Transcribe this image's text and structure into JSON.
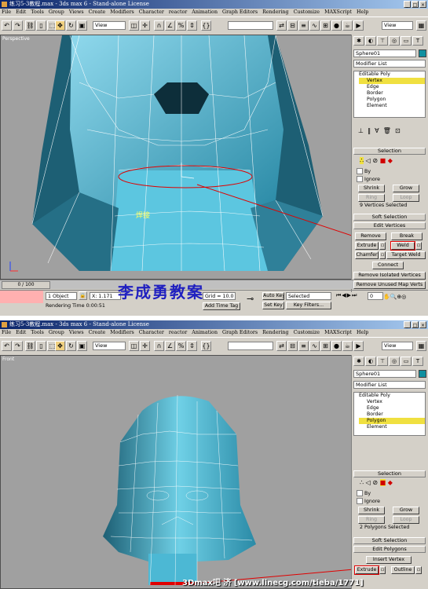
{
  "screen1": {
    "title": "练习5-3教程.max - 3ds max 6 - Stand-alone License",
    "menu": [
      "File",
      "Edit",
      "Tools",
      "Group",
      "Views",
      "Create",
      "Modifiers",
      "Character",
      "reactor",
      "Animation",
      "Graph Editors",
      "Rendering",
      "Customize",
      "MAXScript",
      "Help"
    ],
    "viewport_label": "Perspective",
    "view_dropdown": "View",
    "view_dropdown_right": "View",
    "object_name": "Sphere01",
    "modifier_list": "Modifier List",
    "stack": [
      "Editable Poly",
      "Vertex",
      "Edge",
      "Border",
      "Polygon",
      "Element"
    ],
    "stack_selected": "Vertex",
    "selection_rollout": "Selection",
    "by_label": "By",
    "ignore_label": "Ignore",
    "shrink": "Shrink",
    "grow": "Grow",
    "ring": "Ring",
    "loop": "Loop",
    "selected_count": "9 Vertices Selected",
    "soft_selection": "Soft Selection",
    "edit_vertices": "Edit Vertices",
    "remove": "Remove",
    "break": "Break",
    "extrude": "Extrude",
    "weld": "Weld",
    "chamfer": "Chamfer",
    "target_weld": "Target Weld",
    "connect": "Connect",
    "remove_isolated": "Remove Isolated Vertices",
    "remove_unused": "Remove Unused Map Verts",
    "annotation": "焊接",
    "time_slider": "0 / 100",
    "objects_selected": "1 Object",
    "coord_x": "X: 1.171",
    "grid": "Grid = 10.0",
    "rendering_time": "Rendering Time  0:00:51",
    "add_time_tag": "Add Time Tag",
    "auto_key": "Auto Key",
    "set_key": "Set Key",
    "selected_dd": "Selected",
    "key_filters": "Key Filters...",
    "frame": "0",
    "watermark_cn": "李成勇教案"
  },
  "screen2": {
    "title": "练习5-3教程.max - 3ds max 6 - Stand-alone License",
    "menu": [
      "File",
      "Edit",
      "Tools",
      "Group",
      "Views",
      "Create",
      "Modifiers",
      "Character",
      "reactor",
      "Animation",
      "Graph Editors",
      "Rendering",
      "Customize",
      "MAXScript",
      "Help"
    ],
    "viewport_label": "Front",
    "view_dropdown": "View",
    "view_dropdown_right": "View",
    "object_name": "Sphere01",
    "modifier_list": "Modifier List",
    "stack": [
      "Editable Poly",
      "Vertex",
      "Edge",
      "Border",
      "Polygon",
      "Element"
    ],
    "stack_selected": "Polygon",
    "selection_rollout": "Selection",
    "by_label": "By",
    "ignore_label": "Ignore",
    "shrink": "Shrink",
    "grow": "Grow",
    "ring": "Ring",
    "loop": "Loop",
    "selected_count": "2 Polygons Selected",
    "soft_selection": "Soft Selection",
    "edit_polygons": "Edit Polygons",
    "insert_vertex": "Insert Vertex",
    "extrude": "Extrude",
    "outline": "Outline"
  },
  "footer_watermark": "3Dmax吧 济 [www.linecg.com/tieba/1771]",
  "colors": {
    "mesh": "#3aa8c4",
    "mesh_dark": "#1d5f74",
    "viewport_bg": "#a0a0a0",
    "title_start": "#0a246a",
    "highlight": "#f0e040",
    "annotation_red": "#e00000"
  }
}
